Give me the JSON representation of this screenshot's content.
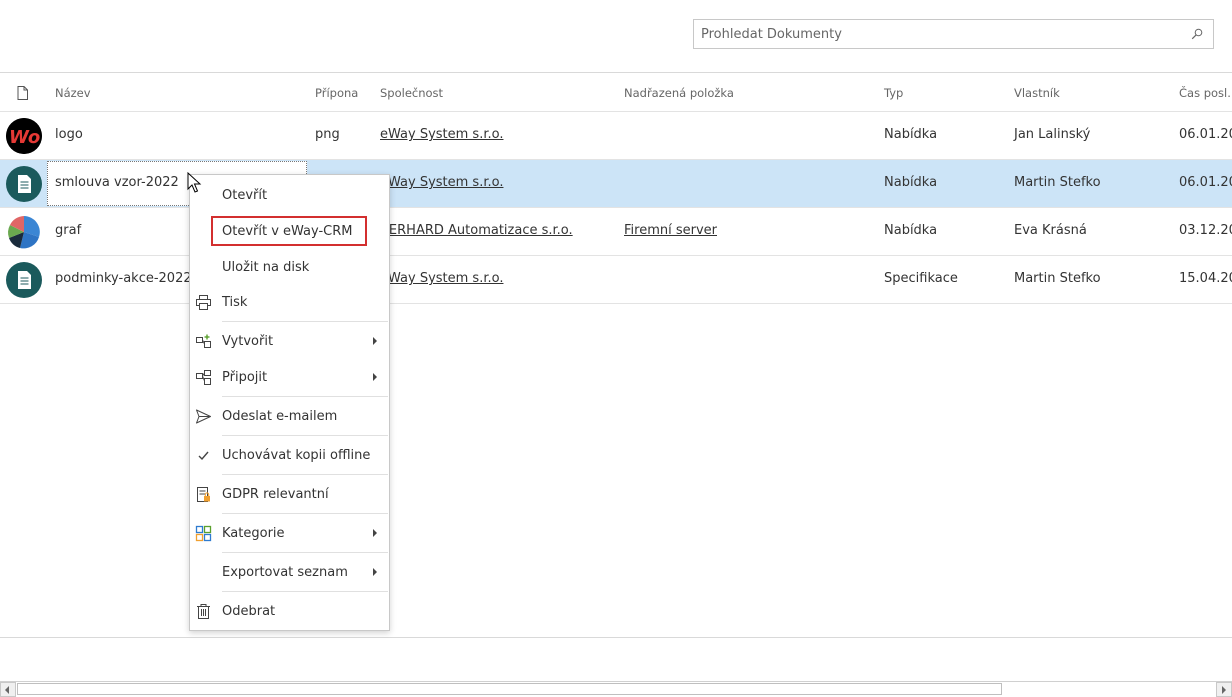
{
  "search": {
    "placeholder": "Prohledat Dokumenty"
  },
  "table": {
    "columns": [
      "Název",
      "Přípona",
      "Společnost",
      "Nadřazená položka",
      "Typ",
      "Vlastník",
      "Čas posl. z"
    ],
    "rows": [
      {
        "name": "logo",
        "ext": "png",
        "company": "eWay System s.r.o.",
        "parent": "",
        "type": "Nabídka",
        "owner": "Jan Lalinský",
        "time": "06.01.20"
      },
      {
        "name": "smlouva vzor-2022",
        "ext": "",
        "company": "eWay System s.r.o.",
        "parent": "",
        "type": "Nabídka",
        "owner": "Martin Stefko",
        "time": "06.01.20"
      },
      {
        "name": "graf",
        "ext": "",
        "company": "BERHARD Automatizace s.r.o.",
        "parent": "Firemní server",
        "type": "Nabídka",
        "owner": "Eva Krásná",
        "time": "03.12.20"
      },
      {
        "name": "podminky-akce-2022",
        "ext": "",
        "company": "eWay System s.r.o.",
        "parent": "",
        "type": "Specifikace",
        "owner": "Martin Stefko",
        "time": "15.04.20"
      }
    ]
  },
  "context_menu": {
    "items": [
      {
        "label": "Otevřít"
      },
      {
        "label": "Otevřít v eWay-CRM"
      },
      {
        "label": "Uložit na disk"
      },
      {
        "label": "Tisk"
      },
      {
        "label": "Vytvořit"
      },
      {
        "label": "Připojit"
      },
      {
        "label": "Odeslat e-mailem"
      },
      {
        "label": "Uchovávat kopii offline"
      },
      {
        "label": "GDPR relevantní"
      },
      {
        "label": "Kategorie"
      },
      {
        "label": "Exportovat seznam"
      },
      {
        "label": "Odebrat"
      }
    ]
  },
  "colors": {
    "selected_row": "#cce4f7",
    "doc_avatar": "#1b5a5c",
    "highlight": "#d32f2f"
  },
  "logo_text": "Wo"
}
